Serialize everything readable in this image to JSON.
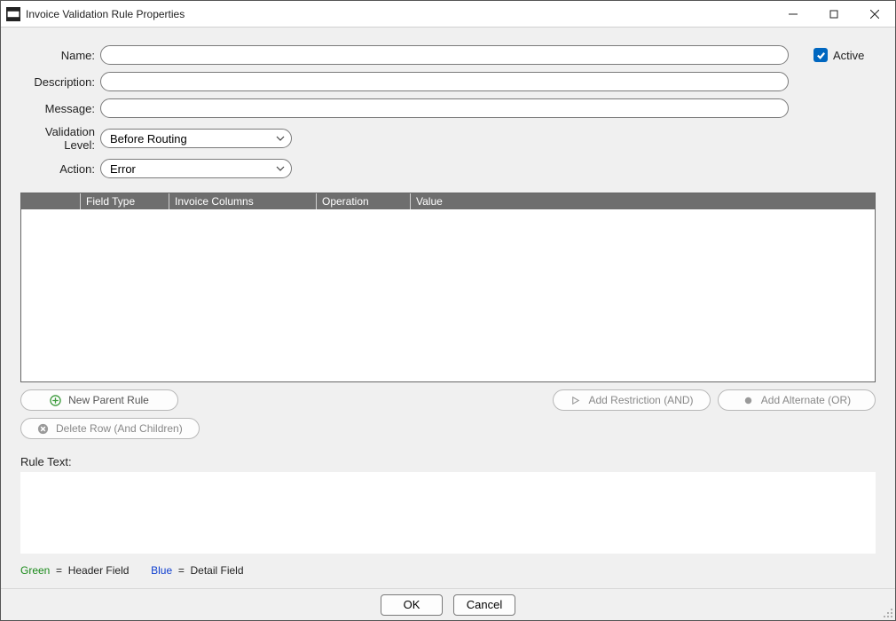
{
  "window": {
    "title": "Invoice Validation Rule Properties"
  },
  "form": {
    "name_label": "Name:",
    "name_value": "",
    "description_label": "Description:",
    "description_value": "",
    "message_label": "Message:",
    "message_value": "",
    "validation_level_label": "Validation Level:",
    "validation_level_value": "Before Routing",
    "action_label": "Action:",
    "action_value": "Error",
    "active_label": "Active",
    "active_checked": true
  },
  "grid": {
    "columns": [
      "",
      "Field Type",
      "Invoice Columns",
      "Operation",
      "Value"
    ]
  },
  "buttons": {
    "new_parent": "New Parent Rule",
    "add_restriction": "Add Restriction (AND)",
    "add_alternate": "Add Alternate (OR)",
    "delete_row": "Delete Row (And Children)"
  },
  "rule_text": {
    "label": "Rule Text:",
    "value": ""
  },
  "legend": {
    "green_label": "Green",
    "green_desc": "Header Field",
    "blue_label": "Blue",
    "blue_desc": "Detail Field",
    "eq": "="
  },
  "footer": {
    "ok": "OK",
    "cancel": "Cancel"
  }
}
